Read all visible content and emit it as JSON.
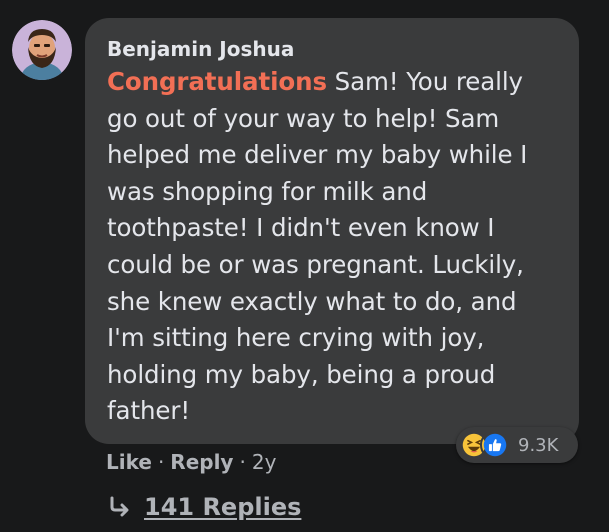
{
  "comment": {
    "author": "Benjamin Joshua",
    "mention": "Congratulations",
    "text": " Sam! You really go out of your way to help! Sam helped me deliver my baby while I was shopping for milk and toothpaste! I didn't even know I could be or was pregnant. Luckily, she knew exactly what to do, and I'm sitting here crying with joy, holding my baby, being a proud father!",
    "reactions": {
      "icons": [
        "haha-icon",
        "like-icon"
      ],
      "count": "9.3K"
    },
    "actions": {
      "like": "Like",
      "reply": "Reply",
      "separator": "·",
      "time": "2y"
    },
    "replies": {
      "label": "141 Replies",
      "icon": "reply-arrow-icon"
    }
  },
  "colors": {
    "background": "#18191a",
    "bubble": "#3a3b3c",
    "mention": "#f26f55",
    "text": "#e4e6eb",
    "secondary_text": "#b0b3b8",
    "like_blue": "#1877f2",
    "haha_yellow": "#f7c33a"
  }
}
